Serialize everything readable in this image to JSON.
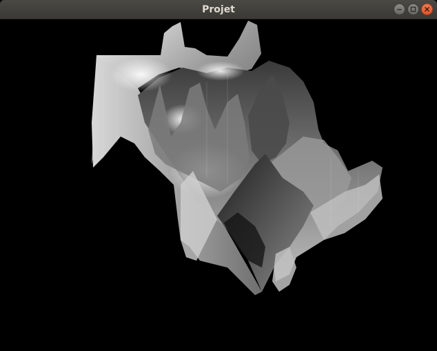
{
  "window": {
    "title": "Projet"
  },
  "controls": {
    "minimize": "minimize-icon",
    "maximize": "maximize-icon",
    "close": "close-icon"
  },
  "colors": {
    "titlebar": "#3c3b37",
    "close": "#e95420",
    "background": "#000000"
  }
}
